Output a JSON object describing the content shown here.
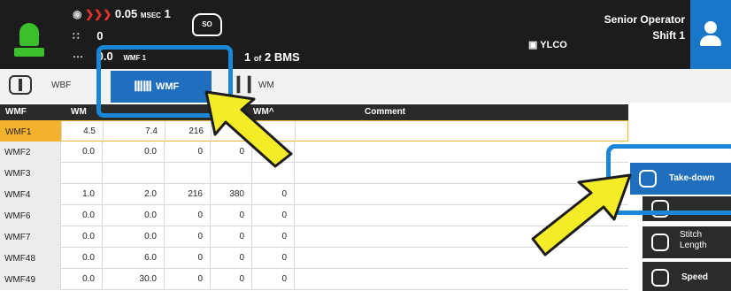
{
  "topbar": {
    "speed_value": "0.05",
    "speed_unit": "MSEC",
    "speed_count": "1",
    "value2": "0",
    "value3": "0.0",
    "value3_tag": "WMF 1",
    "so_label": "SO",
    "bms_current": "1",
    "bms_of": "of",
    "bms_total": "2",
    "bms_label": "BMS",
    "ylco": "YLCO",
    "operator_role": "Senior Operator",
    "shift": "Shift 1"
  },
  "tabs": {
    "wbf": "WBF",
    "wmf": "WMF",
    "wm": "WM"
  },
  "table": {
    "headers": [
      "WMF",
      "WM",
      "",
      "",
      "WM^",
      "Comment"
    ],
    "rows": [
      {
        "name": "WMF1",
        "v1": "4.5",
        "v2": "7.4",
        "v3": "216",
        "v4": "3",
        "v5": ""
      },
      {
        "name": "WMF2",
        "v1": "0.0",
        "v2": "0.0",
        "v3": "0",
        "v4": "0",
        "v5": ""
      },
      {
        "name": "WMF3",
        "v1": "",
        "v2": "",
        "v3": "",
        "v4": "",
        "v5": ""
      },
      {
        "name": "WMF4",
        "v1": "1.0",
        "v2": "2.0",
        "v3": "216",
        "v4": "380",
        "v5": "0"
      },
      {
        "name": "WMF6",
        "v1": "0.0",
        "v2": "0.0",
        "v3": "0",
        "v4": "0",
        "v5": "0"
      },
      {
        "name": "WMF7",
        "v1": "0.0",
        "v2": "0.0",
        "v3": "0",
        "v4": "0",
        "v5": "0"
      },
      {
        "name": "WMF48",
        "v1": "0.0",
        "v2": "6.0",
        "v3": "0",
        "v4": "0",
        "v5": "0"
      },
      {
        "name": "WMF49",
        "v1": "0.0",
        "v2": "30.0",
        "v3": "0",
        "v4": "0",
        "v5": "0"
      }
    ]
  },
  "side": {
    "takedown": "Take-down",
    "stitch_line1": "Stitch",
    "stitch_line2": "Length",
    "speed": "Speed"
  },
  "colors": {
    "accent": "#1f6fbe",
    "highlight": "#1a86d8",
    "selected_row": "#f4b32c",
    "status_green": "#3bbf2c",
    "arrow_yellow": "#f4ec27"
  }
}
